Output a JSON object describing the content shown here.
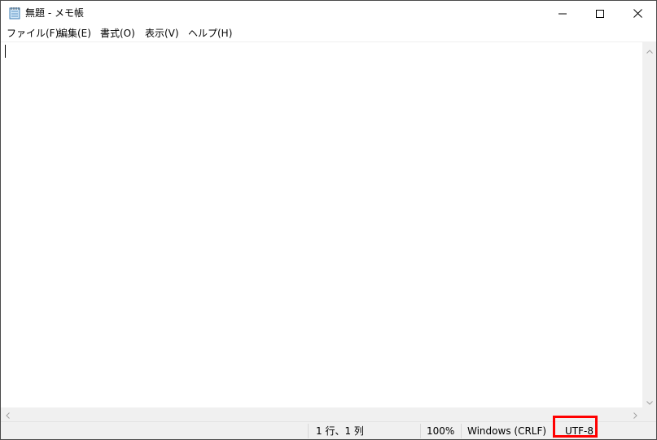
{
  "window": {
    "title": "無題 - メモ帳",
    "app_icon": "notepad-icon"
  },
  "caption_buttons": {
    "minimize_icon": "minimize-icon",
    "maximize_icon": "maximize-icon",
    "close_icon": "close-icon"
  },
  "menu": {
    "items": [
      {
        "label": "ファイル(F)"
      },
      {
        "label": "編集(E)"
      },
      {
        "label": "書式(O)"
      },
      {
        "label": "表示(V)"
      },
      {
        "label": "ヘルプ(H)"
      }
    ]
  },
  "editor": {
    "content": ""
  },
  "statusbar": {
    "position": "1 行、1 列",
    "zoom": "100%",
    "line_ending": "Windows (CRLF)",
    "encoding": "UTF-8"
  },
  "colors": {
    "highlight": "#ff0000",
    "chrome": "#f0f0f0"
  }
}
